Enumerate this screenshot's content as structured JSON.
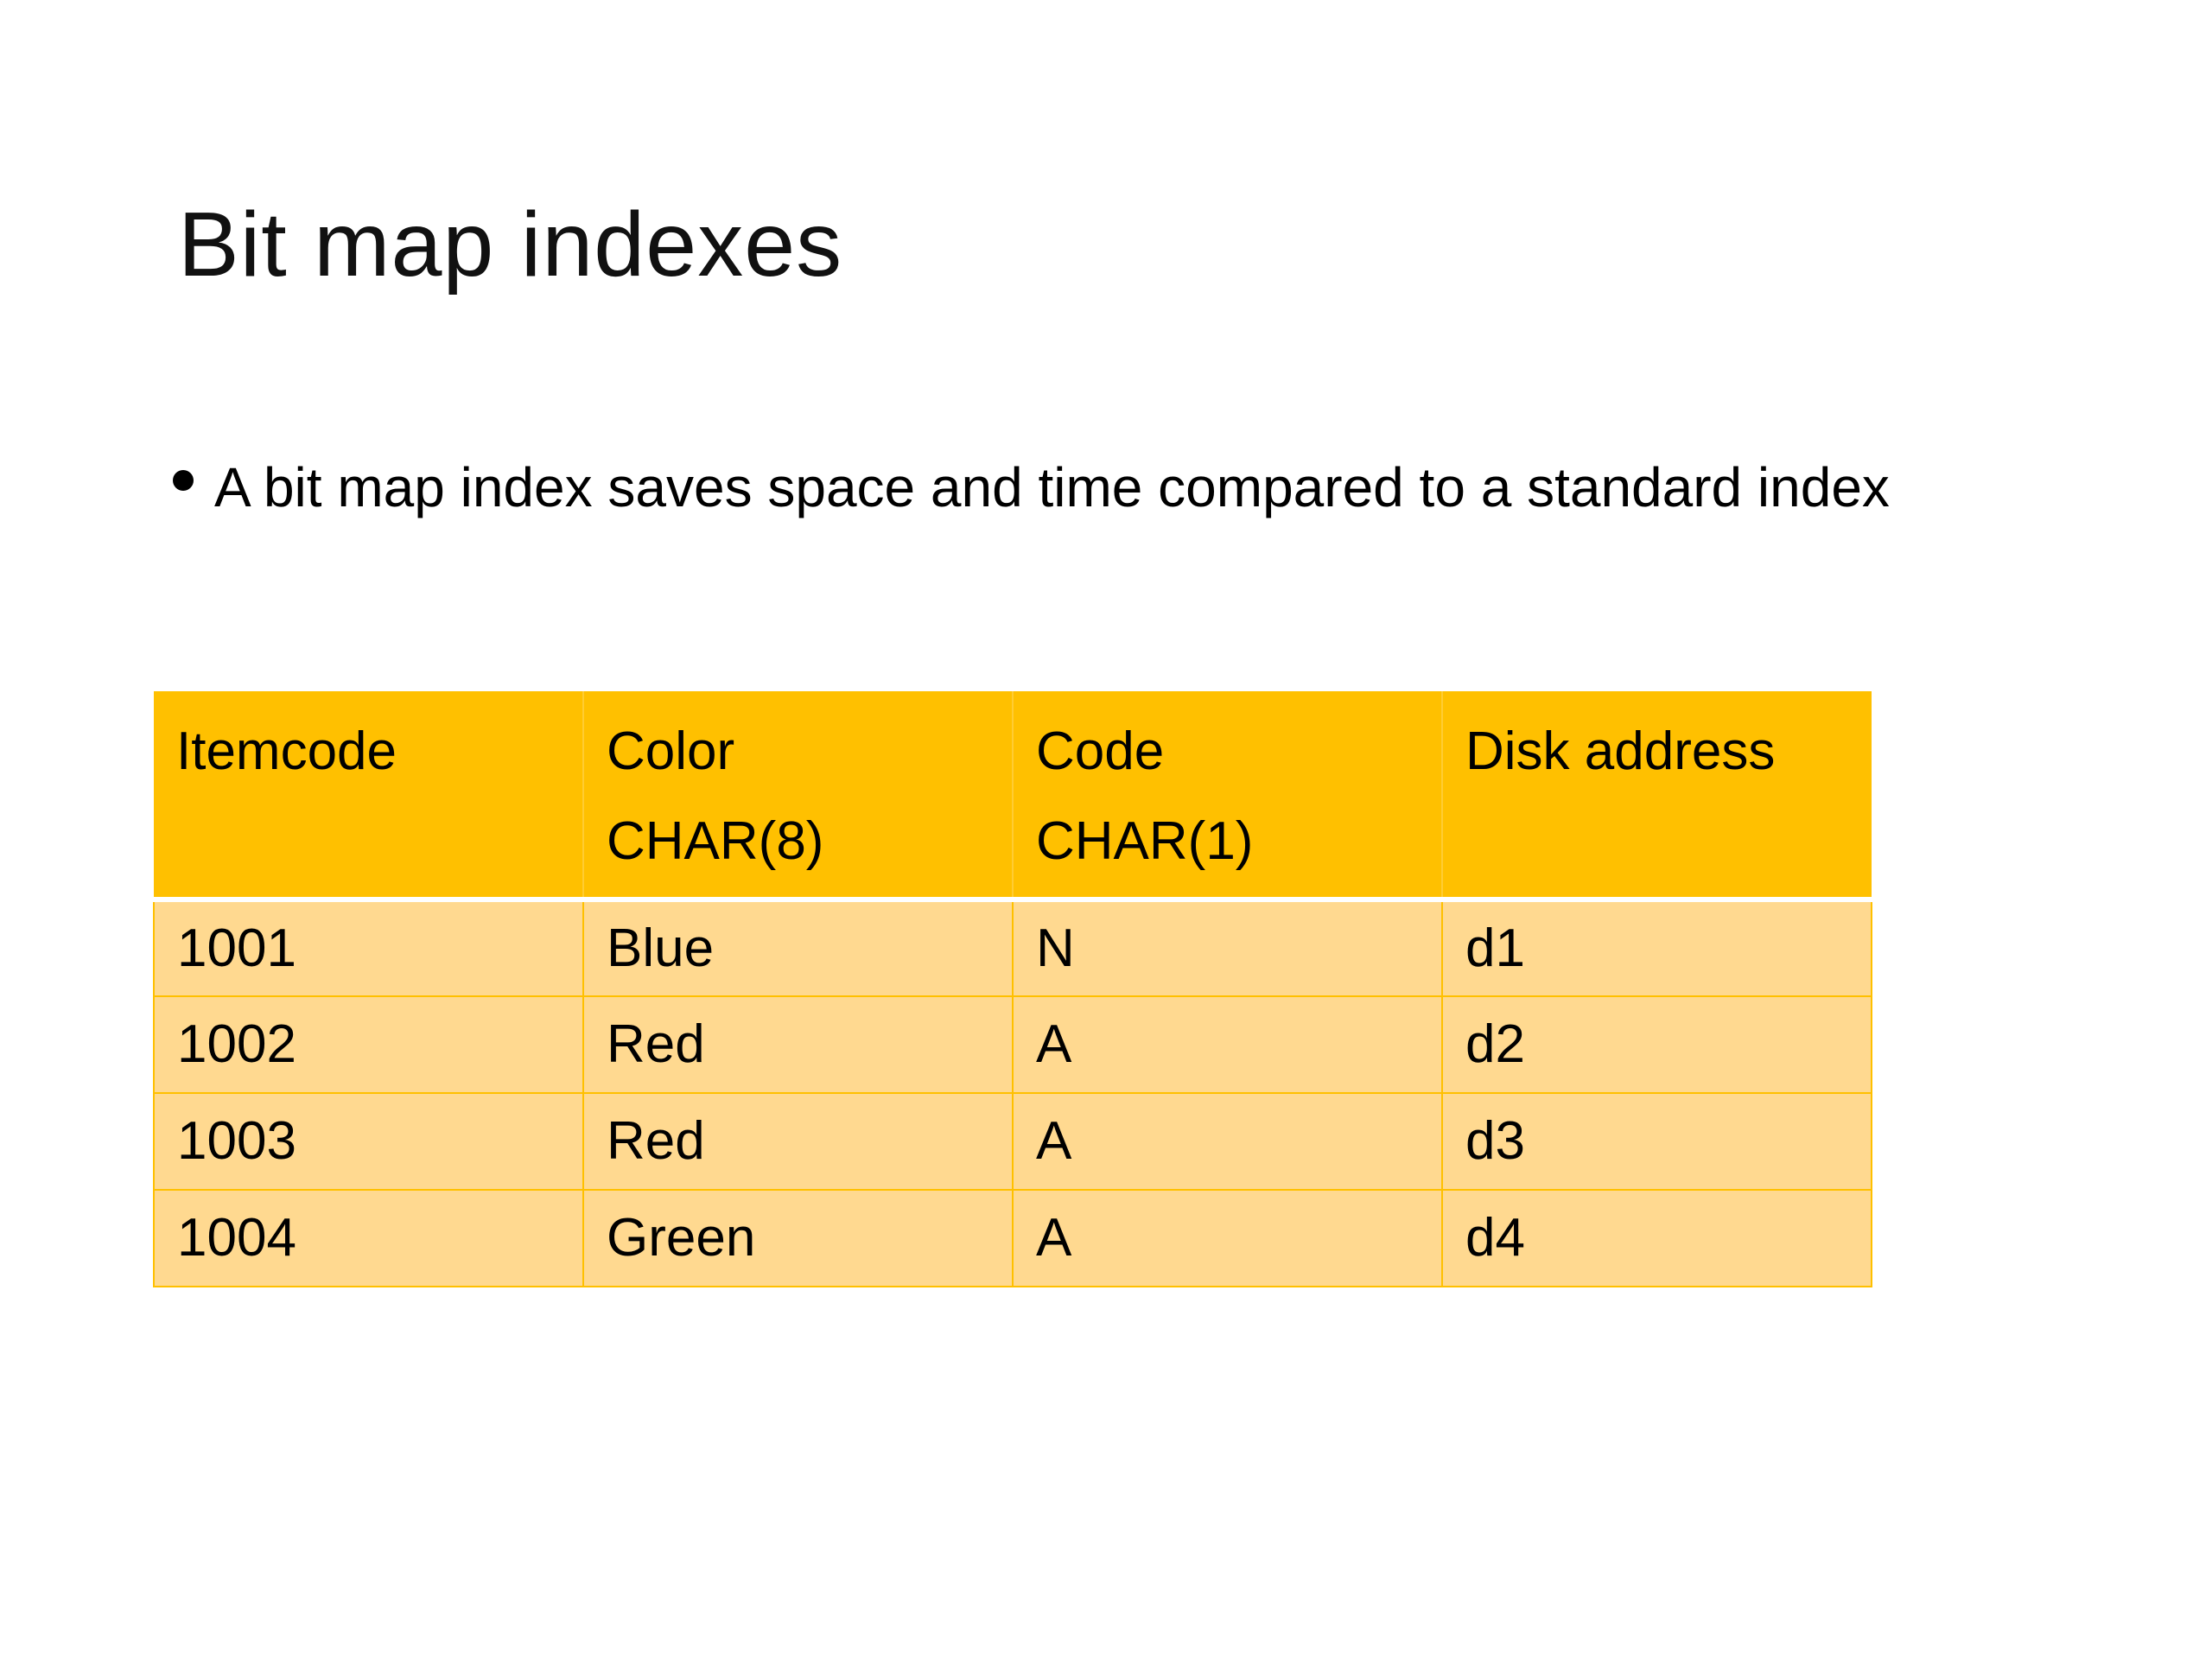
{
  "slide": {
    "title": "Bit map indexes",
    "bullets": [
      "A bit map index saves space and time compared to a standard index"
    ]
  },
  "table": {
    "columns": [
      {
        "label": "Itemcode",
        "sublabel": ""
      },
      {
        "label": "Color",
        "sublabel": "CHAR(8)"
      },
      {
        "label": "Code",
        "sublabel": "CHAR(1)"
      },
      {
        "label": "Disk address",
        "sublabel": ""
      }
    ],
    "rows": [
      [
        "1001",
        "Blue",
        "N",
        "d1"
      ],
      [
        "1002",
        "Red",
        "A",
        "d2"
      ],
      [
        "1003",
        "Red",
        "A",
        "d3"
      ],
      [
        "1004",
        "Green",
        "A",
        "d4"
      ]
    ]
  },
  "colors": {
    "header_fill": "#FFC000",
    "row_fill": "#FFD990",
    "background": "#ffffff"
  }
}
